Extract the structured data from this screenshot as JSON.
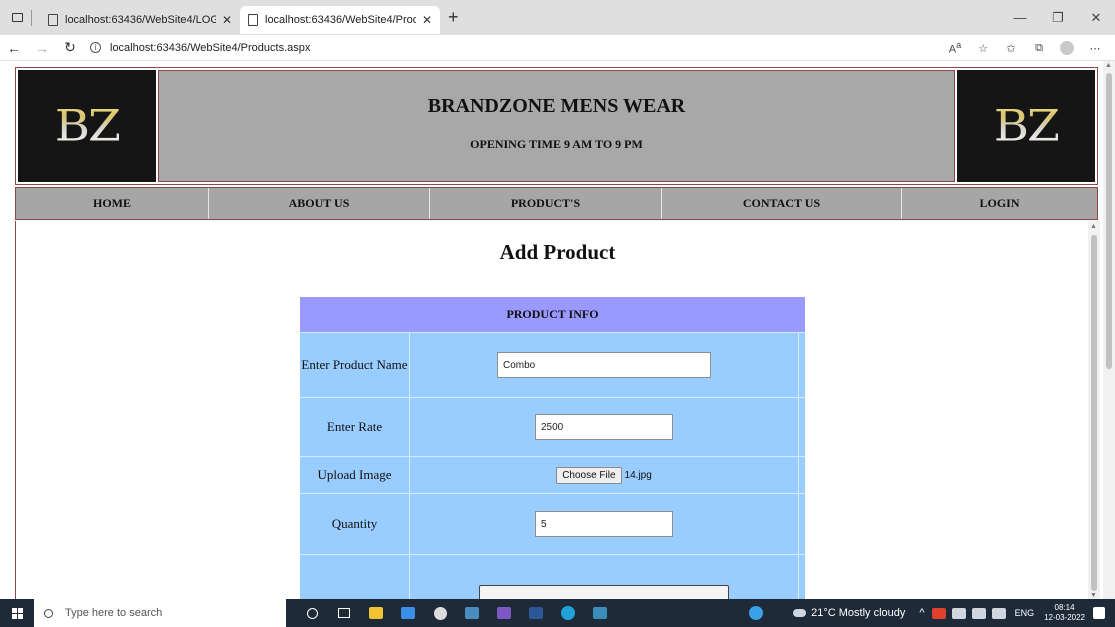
{
  "browser": {
    "tabs": [
      {
        "title": "localhost:63436/WebSite4/LOGIN",
        "active": false
      },
      {
        "title": "localhost:63436/WebSite4/Produ",
        "active": true
      }
    ],
    "url": "localhost:63436/WebSite4/Products.aspx"
  },
  "header": {
    "logo_text": "BZ",
    "title": "BRANDZONE MENS WEAR",
    "subtitle": "OPENING TIME 9 AM TO 9 PM"
  },
  "nav": [
    {
      "label": "HOME"
    },
    {
      "label": "ABOUT US"
    },
    {
      "label": "PRODUCT'S"
    },
    {
      "label": "CONTACT US"
    },
    {
      "label": "LOGIN"
    }
  ],
  "page": {
    "title": "Add Product",
    "form_header": "PRODUCT INFO",
    "fields": {
      "name": {
        "label": "Enter Product Name",
        "value": "Combo"
      },
      "rate": {
        "label": "Enter Rate",
        "value": "2500"
      },
      "image": {
        "label": "Upload Image",
        "button": "Choose File",
        "filename": "14.jpg"
      },
      "quantity": {
        "label": "Quantity",
        "value": "5"
      }
    }
  },
  "taskbar": {
    "search_placeholder": "Type here to search",
    "weather": "21°C  Mostly cloudy",
    "lang": "ENG",
    "time": "08:14",
    "date": "12-03-2022"
  },
  "colors": {
    "form_header": "#9999ff",
    "form_body": "#99ccff",
    "banner": "#a8a8a8",
    "border": "#8d4848"
  }
}
